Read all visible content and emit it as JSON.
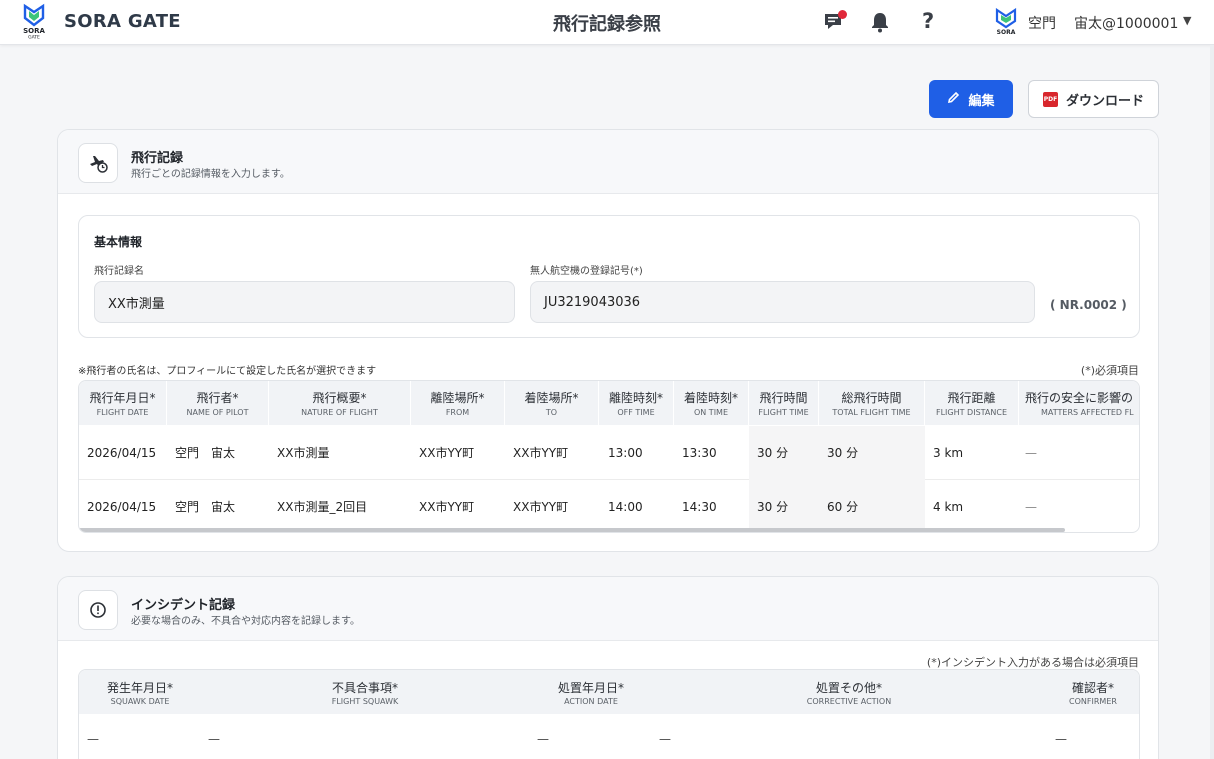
{
  "header": {
    "brand": "SORA GATE",
    "logo_text": "SORA GATE",
    "page_title": "飛行記録参照",
    "user_name": "空門",
    "user_id": "宙太@1000001",
    "help_label": "?",
    "caret": "▼",
    "icons": [
      "message-alert-icon",
      "bell-icon",
      "help-icon",
      "sora-gate-logo"
    ],
    "accent_color": "#1f5fe6",
    "notification_dot_color": "#e0283a"
  },
  "actions": {
    "edit_label": "編集",
    "download_label": "ダウンロード",
    "pdf_badge": "PDF"
  },
  "flight_record": {
    "title": "飛行記録",
    "subtitle": "飛行ごとの記録情報を入力します。",
    "basic": {
      "title": "基本情報",
      "name_label": "飛行記録名",
      "name_value": "XX市測量",
      "reg_label": "無人航空機の登録記号(*)",
      "reg_value": "JU3219043036",
      "nr": "( NR.0002 )"
    },
    "note_left": "※飛行者の氏名は、プロフィールにて設定した氏名が選択できます",
    "note_right": "(*)必須項目",
    "columns": [
      {
        "jp": "飛行年月日*",
        "en": "FLIGHT DATE"
      },
      {
        "jp": "飛行者*",
        "en": "NAME OF PILOT"
      },
      {
        "jp": "飛行概要*",
        "en": "NATURE OF FLIGHT"
      },
      {
        "jp": "離陸場所*",
        "en": "FROM"
      },
      {
        "jp": "着陸場所*",
        "en": "TO"
      },
      {
        "jp": "離陸時刻*",
        "en": "OFF TIME"
      },
      {
        "jp": "着陸時刻*",
        "en": "ON TIME"
      },
      {
        "jp": "飛行時間",
        "en": "FLIGHT TIME"
      },
      {
        "jp": "総飛行時間",
        "en": "TOTAL FLIGHT TIME"
      },
      {
        "jp": "飛行距離",
        "en": "FLIGHT DISTANCE"
      },
      {
        "jp": "飛行の安全に影響の",
        "en": "MATTERS AFFECTED FL"
      }
    ],
    "rows": [
      [
        "2026/04/15",
        "空門　宙太",
        "XX市測量",
        "XX市YY町",
        "XX市YY町",
        "13:00",
        "13:30",
        "30 分",
        "30 分",
        "3 km",
        "—"
      ],
      [
        "2026/04/15",
        "空門　宙太",
        "XX市測量_2回目",
        "XX市YY町",
        "XX市YY町",
        "14:00",
        "14:30",
        "30 分",
        "60 分",
        "4 km",
        "—"
      ]
    ]
  },
  "incident": {
    "title": "インシデント記録",
    "subtitle": "必要な場合のみ、不具合や対応内容を記録します。",
    "note_right": "(*)インシデント入力がある場合は必須項目",
    "columns": [
      {
        "jp": "発生年月日*",
        "en": "SQUAWK DATE"
      },
      {
        "jp": "不具合事項*",
        "en": "FLIGHT SQUAWK"
      },
      {
        "jp": "処置年月日*",
        "en": "ACTION DATE"
      },
      {
        "jp": "処置その他*",
        "en": "CORRECTIVE ACTION"
      },
      {
        "jp": "確認者*",
        "en": "CONFIRMER"
      }
    ],
    "row": [
      "—",
      "—",
      "—",
      "—",
      "—"
    ]
  }
}
